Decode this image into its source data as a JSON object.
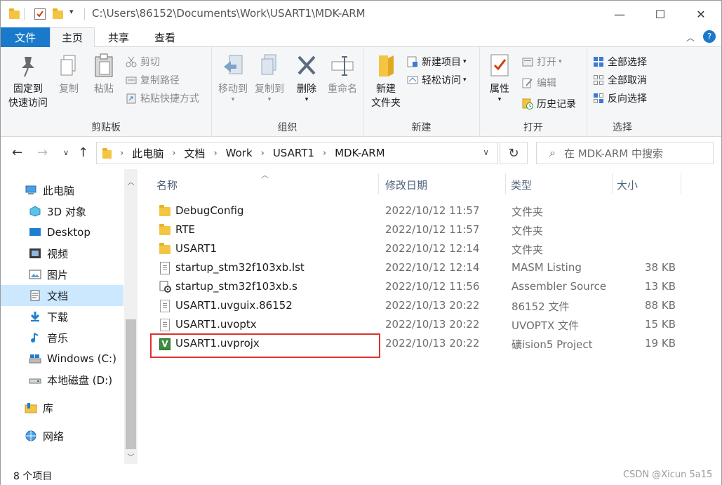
{
  "window": {
    "title_path": "C:\\Users\\86152\\Documents\\Work\\USART1\\MDK-ARM",
    "minimize": "—",
    "maximize": "☐",
    "close": "✕"
  },
  "ribbon_tabs": {
    "file": "文件",
    "home": "主页",
    "share": "共享",
    "view": "查看"
  },
  "ribbon": {
    "clipboard": {
      "label": "剪贴板",
      "pin_line1": "固定到",
      "pin_line2": "快速访问",
      "copy": "复制",
      "paste": "粘贴",
      "cut": "剪切",
      "copy_path": "复制路径",
      "paste_shortcut": "粘贴快捷方式"
    },
    "organize": {
      "label": "组织",
      "move_to": "移动到",
      "copy_to": "复制到",
      "delete": "删除",
      "rename": "重命名"
    },
    "new": {
      "label": "新建",
      "new_folder_line1": "新建",
      "new_folder_line2": "文件夹",
      "new_item": "新建项目",
      "easy_access": "轻松访问"
    },
    "open": {
      "label": "打开",
      "properties": "属性",
      "open": "打开",
      "edit": "编辑",
      "history": "历史记录"
    },
    "select": {
      "label": "选择",
      "select_all": "全部选择",
      "select_none": "全部取消",
      "invert": "反向选择"
    }
  },
  "address": {
    "crumbs": [
      "此电脑",
      "文档",
      "Work",
      "USART1",
      "MDK-ARM"
    ],
    "search_placeholder": "在 MDK-ARM 中搜索"
  },
  "nav_pane": [
    {
      "label": "此电脑",
      "icon": "computer-icon"
    },
    {
      "label": "3D 对象",
      "icon": "cube-icon"
    },
    {
      "label": "Desktop",
      "icon": "desktop-icon"
    },
    {
      "label": "视频",
      "icon": "video-icon"
    },
    {
      "label": "图片",
      "icon": "pictures-icon"
    },
    {
      "label": "文档",
      "icon": "documents-icon",
      "selected": true
    },
    {
      "label": "下载",
      "icon": "download-icon"
    },
    {
      "label": "音乐",
      "icon": "music-icon"
    },
    {
      "label": "Windows (C:)",
      "icon": "drive-icon"
    },
    {
      "label": "本地磁盘 (D:)",
      "icon": "drive-icon"
    },
    {
      "label": "库",
      "icon": "library-icon"
    },
    {
      "label": "网络",
      "icon": "network-icon"
    }
  ],
  "columns": {
    "name": "名称",
    "date": "修改日期",
    "type": "类型",
    "size": "大小"
  },
  "files": [
    {
      "name": "DebugConfig",
      "date": "2022/10/12 11:57",
      "type": "文件夹",
      "size": "",
      "icon": "folder-icon"
    },
    {
      "name": "RTE",
      "date": "2022/10/12 11:57",
      "type": "文件夹",
      "size": "",
      "icon": "folder-icon"
    },
    {
      "name": "USART1",
      "date": "2022/10/12 12:14",
      "type": "文件夹",
      "size": "",
      "icon": "folder-icon"
    },
    {
      "name": "startup_stm32f103xb.lst",
      "date": "2022/10/12 12:14",
      "type": "MASM Listing",
      "size": "38 KB",
      "icon": "document-icon"
    },
    {
      "name": "startup_stm32f103xb.s",
      "date": "2022/10/12 11:56",
      "type": "Assembler Source",
      "size": "13 KB",
      "icon": "assembler-file-icon"
    },
    {
      "name": "USART1.uvguix.86152",
      "date": "2022/10/13 20:22",
      "type": "86152 文件",
      "size": "88 KB",
      "icon": "document-icon"
    },
    {
      "name": "USART1.uvoptx",
      "date": "2022/10/13 20:22",
      "type": "UVOPTX 文件",
      "size": "15 KB",
      "icon": "document-icon"
    },
    {
      "name": "USART1.uvprojx",
      "date": "2022/10/13 20:22",
      "type": "礦ision5 Project",
      "size": "19 KB",
      "icon": "uvision-project-icon"
    }
  ],
  "status": {
    "count": "8 个项目"
  },
  "watermark": "CSDN @Xicun 5a15"
}
